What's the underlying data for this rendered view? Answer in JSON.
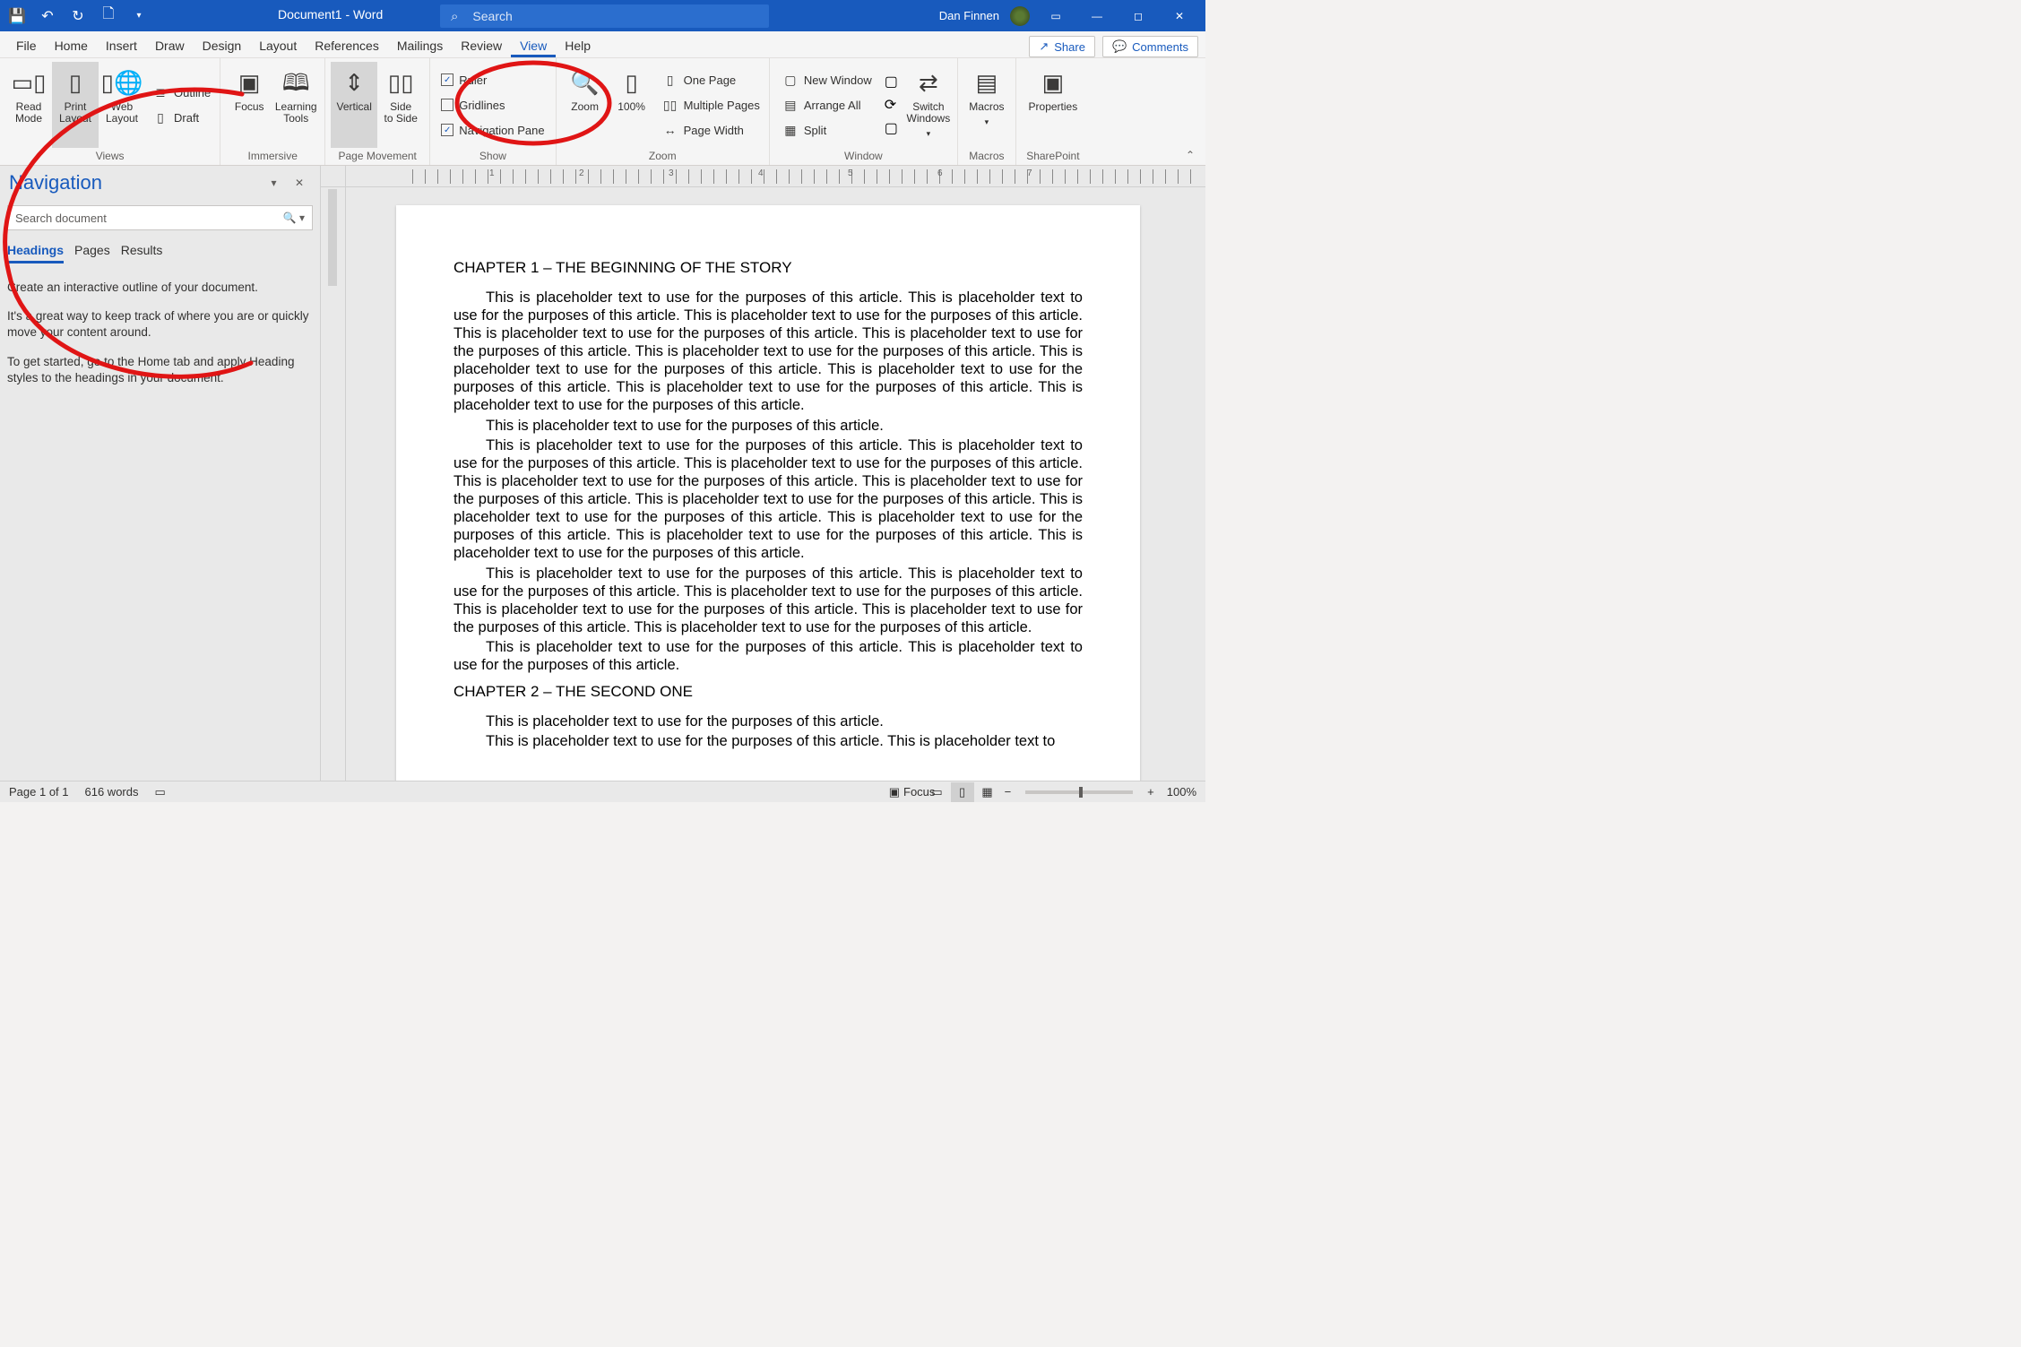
{
  "titlebar": {
    "doc_title": "Document1  -  Word",
    "search_placeholder": "Search",
    "user_name": "Dan Finnen"
  },
  "tabs": {
    "file": "File",
    "home": "Home",
    "insert": "Insert",
    "draw": "Draw",
    "design": "Design",
    "layout": "Layout",
    "references": "References",
    "mailings": "Mailings",
    "review": "Review",
    "view": "View",
    "help": "Help",
    "share": "Share",
    "comments": "Comments"
  },
  "ribbon": {
    "views": {
      "label": "Views",
      "read": "Read\nMode",
      "print": "Print\nLayout",
      "web": "Web\nLayout",
      "outline": "Outline",
      "draft": "Draft"
    },
    "immersive": {
      "label": "Immersive",
      "focus": "Focus",
      "learning": "Learning\nTools"
    },
    "pagemove": {
      "label": "Page Movement",
      "vertical": "Vertical",
      "side": "Side\nto Side"
    },
    "show": {
      "label": "Show",
      "ruler": "Ruler",
      "gridlines": "Gridlines",
      "navpane": "Navigation Pane"
    },
    "zoom": {
      "label": "Zoom",
      "zoom": "Zoom",
      "p100": "100%",
      "onepage": "One Page",
      "multipage": "Multiple Pages",
      "pagewidth": "Page Width"
    },
    "window": {
      "label": "Window",
      "neww": "New Window",
      "arrange": "Arrange All",
      "split": "Split",
      "switch": "Switch\nWindows"
    },
    "macros": {
      "label": "Macros",
      "macros": "Macros"
    },
    "sharepoint": {
      "label": "SharePoint",
      "props": "Properties"
    }
  },
  "nav": {
    "title": "Navigation",
    "search_placeholder": "Search document",
    "tabs": {
      "headings": "Headings",
      "pages": "Pages",
      "results": "Results"
    },
    "p1": "Create an interactive outline of your document.",
    "p2": "It's a great way to keep track of where you are or quickly move your content around.",
    "p3": "To get started, go to the Home tab and apply Heading styles to the headings in your document."
  },
  "doc": {
    "h1": "CHAPTER 1 – THE BEGINNING OF THE STORY",
    "h2": "CHAPTER 2 – THE SECOND ONE",
    "p1": "This is placeholder text to use for the purposes of this article. This is placeholder text to use for the purposes of this article. This is placeholder text to use for the purposes of this article. This is placeholder text to use for the purposes of this article. This is placeholder text to use for the purposes of this article. This is placeholder text to use for the purposes of this article. This is placeholder text to use for the purposes of this article. This is placeholder text to use for the purposes of this article. This is placeholder text to use for the purposes of this article. This is placeholder text to use for the purposes of this article.",
    "p2": "This is placeholder text to use for the purposes of this article.",
    "p3": "This is placeholder text to use for the purposes of this article. This is placeholder text to use for the purposes of this article. This is placeholder text to use for the purposes of this article. This is placeholder text to use for the purposes of this article. This is placeholder text to use for the purposes of this article. This is placeholder text to use for the purposes of this article. This is placeholder text to use for the purposes of this article. This is placeholder text to use for the purposes of this article. This is placeholder text to use for the purposes of this article. This is placeholder text to use for the purposes of this article.",
    "p4": "This is placeholder text to use for the purposes of this article. This is placeholder text to use for the purposes of this article. This is placeholder text to use for the purposes of this article. This is placeholder text to use for the purposes of this article. This is placeholder text to use for the purposes of this article. This is placeholder text to use for the purposes of this article.",
    "p5": "This is placeholder text to use for the purposes of this article. This is placeholder text to use for the purposes of this article.",
    "p6": "This is placeholder text to use for the purposes of this article.",
    "p7": "This is placeholder text to use for the purposes of this article. This is placeholder text to"
  },
  "status": {
    "page": "Page 1 of 1",
    "words": "616 words",
    "focus": "Focus",
    "zoom": "100%"
  }
}
